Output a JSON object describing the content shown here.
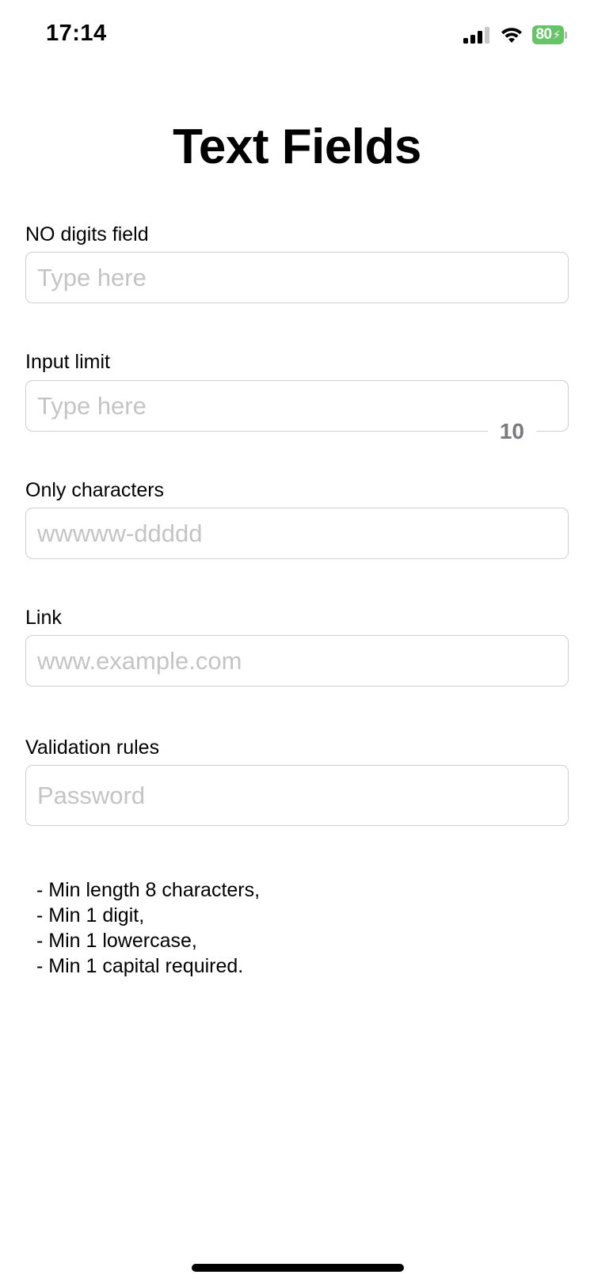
{
  "status_bar": {
    "time": "17:14",
    "battery_level": "80",
    "battery_color": "#65c466",
    "icons": [
      "signal-icon",
      "wifi-icon",
      "battery-icon",
      "charging-bolt-icon"
    ]
  },
  "page": {
    "title": "Text Fields"
  },
  "fields": [
    {
      "label": "NO digits field",
      "placeholder": "Type here",
      "value": ""
    },
    {
      "label": "Input limit",
      "placeholder": "Type here",
      "value": "",
      "counter": "10"
    },
    {
      "label": "Only characters",
      "placeholder": "wwwww-ddddd",
      "value": ""
    },
    {
      "label": "Link",
      "placeholder": "www.example.com",
      "value": ""
    },
    {
      "label": "Validation rules",
      "placeholder": "Password",
      "value": ""
    }
  ],
  "validation_rules": [
    "- Min length 8 characters,",
    "- Min 1 digit,",
    "- Min 1 lowercase,",
    "- Min 1 capital required."
  ],
  "colors": {
    "field_border": "#cfcfd3",
    "placeholder": "#c4c4c7",
    "counter": "#7a7a7e"
  }
}
